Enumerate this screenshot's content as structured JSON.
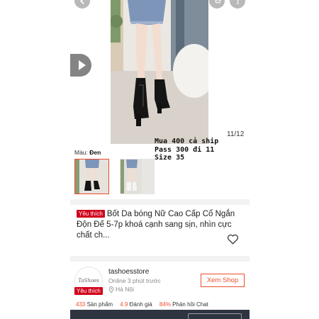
{
  "gallery": {
    "counter": "11/12",
    "overlay_note": "Mua 400 cả ship\nPass 300 đi 11\nSize 35",
    "color_label": "Màu:",
    "color_value": "Đen"
  },
  "icons": {
    "back": "chevron-left-icon",
    "cart": "cart-icon",
    "more": "more-icon",
    "play": "play-icon",
    "favorite": "heart-outline-icon",
    "location": "location-pin-icon"
  },
  "product": {
    "badge": "Yêu thích",
    "title": "Bốt Da bóng Nữ Cao Cấp Cổ Ngắn Độn Đế 5-7p khoá cạnh sang sịn, nhìn cực chất ch..."
  },
  "shop": {
    "avatar_text": "TaShoes",
    "badge": "Yêu thích",
    "name": "tashoesstore",
    "online": "Online 3 phút trước",
    "location": "Hà Nội",
    "view_button": "Xem Shop",
    "stats": [
      {
        "value": "433",
        "label": "Sản phẩm"
      },
      {
        "value": "4.9",
        "label": "Đánh giá"
      },
      {
        "value": "84%",
        "label": "Phản hồi Chat"
      }
    ]
  },
  "colors": {
    "accent": "#ee4d2d",
    "badge": "#d0011b",
    "divider": "#f2f2f2"
  }
}
